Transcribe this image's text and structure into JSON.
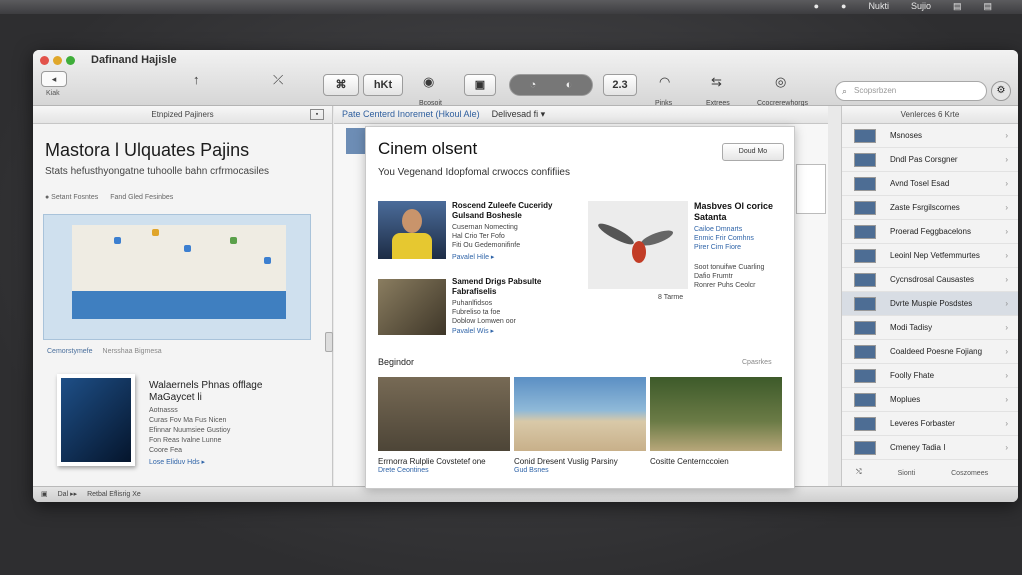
{
  "menubar": {
    "items": [
      "●",
      "●",
      "Nukti",
      "Sujio",
      "▤",
      "▤"
    ]
  },
  "window": {
    "title": "Dafinand Hajisle",
    "back_label": "Kiak",
    "back_glyph": "◂"
  },
  "toolbar": {
    "items": [
      {
        "glyph": "↑"
      },
      {
        "glyph": "⤫"
      },
      {
        "glyph": "⌘",
        "boxed": true
      },
      {
        "glyph": "hKt",
        "boxed": true
      },
      {
        "glyph": "◉",
        "label": "Bcosoit"
      },
      {
        "glyph": "▣",
        "boxed": true
      },
      {
        "glyph": "◔",
        "boxed": true
      },
      {
        "glyph": "◐",
        "boxed": true
      },
      {
        "glyph": "2.3",
        "boxed": true
      },
      {
        "glyph": "◠",
        "label": "Pinks"
      },
      {
        "glyph": "⇆",
        "label": "Extrees"
      },
      {
        "glyph": "◎",
        "label": "Ccocrerewhorgs"
      }
    ],
    "search_placeholder": "Scopsrbzen",
    "gear_glyph": "⚙"
  },
  "left_panel": {
    "header": "Etnpized Pajiners",
    "title": "Mastora l Ulquates Pajins",
    "subtitle": "Stats hefusthyongatne tuhoolle bahn crfrmocasiles",
    "links": [
      "● Setant Fosntes",
      "Fand Gled Fesinbes"
    ],
    "caption": [
      "Cemorstymefe",
      "Nersshaa Bigmesa"
    ],
    "feature_title": "Walaernels Phnas offlage MaGaycet li",
    "feature_meta": "Aotnasss\nCuras Fov Ma Fus Nicen\nEfinnar Nuumsiee Gustioy\nFon Reas Ivalne Lunne\nCoore Fea",
    "feature_link": "Lose Eliduv Hds ▸"
  },
  "middle": {
    "bar_link": "Pate Centerd Inoremet (Hkoul Ale)",
    "bar_label": "Delivesad fi ▾"
  },
  "card": {
    "title": "Cinem olsent",
    "subtitle": "You Vegenand Idopfomal crwoccs confifiies",
    "button": "Doud Mo",
    "items": [
      {
        "title": "Roscend Zuleefe Cuceridy Gulsand Boshesle",
        "meta": "Cusernan Nomecting\nHal Crio Ter Fofo\nFiti Ou Gedemonifinfe",
        "link": "Pavalel Hile ▸"
      },
      {
        "title": "Samend Drigs Pabsulte Fabrafiselis",
        "meta": "Puhanlfidsos\nFubreliso ta foe\nDoblow Lomwen oor",
        "link": "Pavalel Wis ▸"
      }
    ],
    "side_title": "Masbves Ol corice Satanta",
    "side_meta": "Cailoe Dmnarts\nEnmic Frir Comhns\nPirer Cim Fiore",
    "side_meta2": "Soot tonuifwe Cuarling\nDafio Frumtr\nRonrer Puhs Ceolcr",
    "bird_caption": "8 Tarme",
    "section_label": "Begindor",
    "section_right": "Cpasrkes",
    "photos": [
      {
        "caption": "Errnorra Rulplie Covstetef one",
        "sub": "Drete Ceontines"
      },
      {
        "caption": "Conid Dresent Vuslig Parsiny",
        "sub": "Gud Bsnes"
      },
      {
        "caption": "Cositte Centernccoien",
        "sub": ""
      }
    ]
  },
  "right_panel": {
    "header": "Venlerces 6 Krte",
    "items": [
      {
        "label": "Msnoses"
      },
      {
        "label": "Dndl Pas Corsgner"
      },
      {
        "label": "Avnd Tosel Esad"
      },
      {
        "label": "Zaste Fsrgilscornes"
      },
      {
        "label": "Proerad Feggbacelons"
      },
      {
        "label": "Leoinl Nep Vetfemmurtes"
      },
      {
        "label": "Cycnsdrosal Causastes"
      },
      {
        "label": "Dvrte Muspie Posdstes",
        "selected": true
      },
      {
        "label": "Modi Tadisy"
      },
      {
        "label": "Coaldeed Poesne Fojiang"
      },
      {
        "label": "Foolly Fhate"
      },
      {
        "label": "Moplues"
      },
      {
        "label": "Leveres Forbaster"
      },
      {
        "label": "Cmeney Tadia I"
      }
    ],
    "footer": [
      "⤭",
      "Sionti",
      "Coszomees"
    ]
  },
  "status_bar": {
    "items": [
      "▣",
      "Dal ▸▸",
      "Retbal Eflisrig Xe"
    ]
  },
  "colors": {
    "accent": "#2f64a8",
    "selection": "#d8dde4"
  }
}
